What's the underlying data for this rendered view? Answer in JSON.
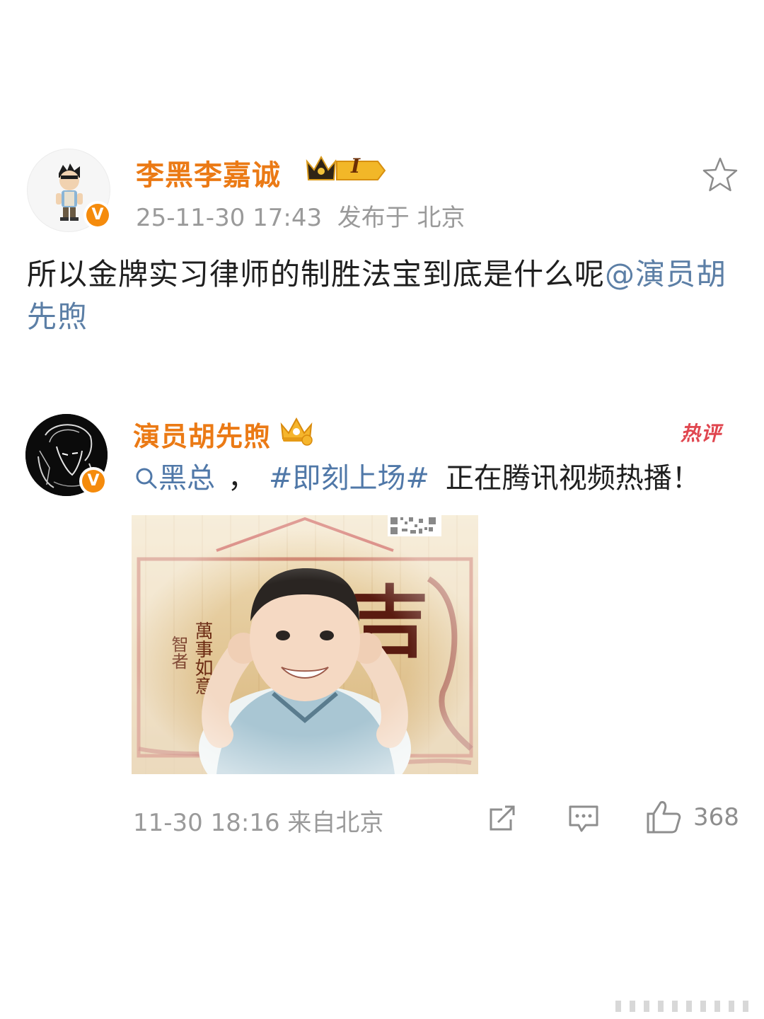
{
  "post": {
    "author": "李黑李嘉诚",
    "level_badge": "I",
    "timestamp": "25-11-30 17:43",
    "location": "发布于 北京",
    "text_before": "所以金牌实习律师的制胜法宝到底是什么呢",
    "mention": "@演员胡先煦"
  },
  "comment": {
    "author": "演员胡先煦",
    "hot_label": "热评",
    "search_term": "黑总",
    "separator": "，",
    "hashtag": "#即刻上场#",
    "text_after": "正在腾讯视频热播！",
    "timestamp": "11-30 18:16",
    "source": "来自北京",
    "like_count": "368"
  },
  "icons": {
    "verified": "V",
    "star": "star-icon",
    "share": "share-icon",
    "comment": "comment-icon",
    "like": "thumbs-up-icon",
    "search": "search-icon"
  },
  "colors": {
    "username": "#eb7a15",
    "link": "#5078a8",
    "hot": "#e0464f",
    "meta": "#9a9a9a"
  }
}
